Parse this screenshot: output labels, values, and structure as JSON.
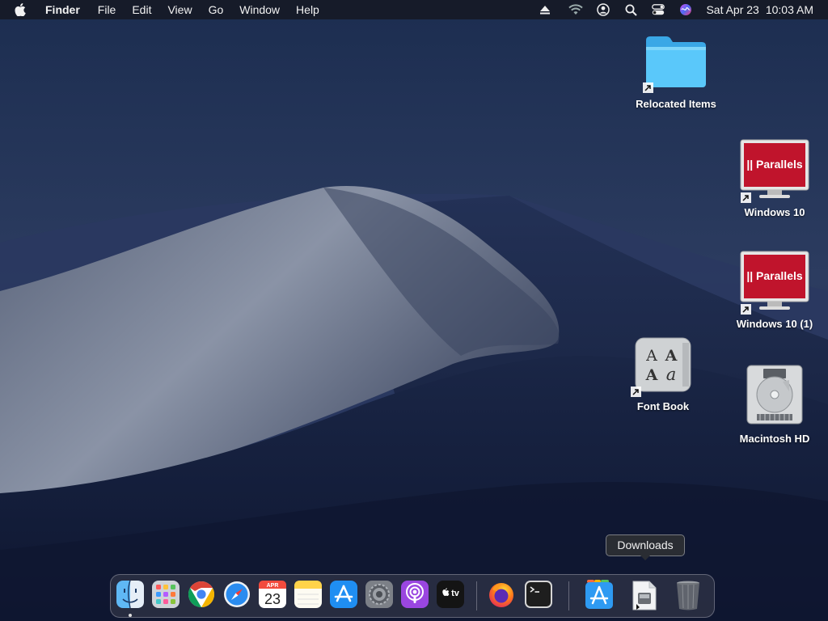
{
  "menubar": {
    "apple_icon": "apple-logo-icon",
    "app_name": "Finder",
    "menus": [
      "File",
      "Edit",
      "View",
      "Go",
      "Window",
      "Help"
    ],
    "status_icons": [
      "eject-icon",
      "wifi-icon",
      "user-icon",
      "search-icon",
      "control-center-icon",
      "siri-icon"
    ],
    "clock": {
      "date": "Sat Apr 23",
      "time": "10:03 AM"
    }
  },
  "desktop": {
    "icons": {
      "relocated_items": "Relocated Items",
      "windows10": "Windows 10",
      "windows10_1": "Windows 10 (1)",
      "font_book": "Font Book",
      "macintosh_hd": "Macintosh HD"
    },
    "parallels_brand": "|| Parallels",
    "fontbook_glyphs": [
      "A",
      "A",
      "A",
      "a"
    ]
  },
  "tooltip": {
    "text": "Downloads"
  },
  "dock": {
    "calendar": {
      "month": "APR",
      "day": "23"
    },
    "tv_label": "tv",
    "items": [
      "Finder",
      "Launchpad",
      "Google Chrome",
      "Safari",
      "Calendar",
      "Notes",
      "App Store",
      "System Preferences",
      "Podcasts",
      "TV",
      "Firefox",
      "Terminal",
      "Applications",
      "Downloads",
      "Trash"
    ]
  },
  "colors": {
    "menubar": "#161a26",
    "folder": "#5ac8fa",
    "parallels_red": "#c0142c",
    "sky_top": "#1b2c4e",
    "dune": "#8a93a6"
  }
}
